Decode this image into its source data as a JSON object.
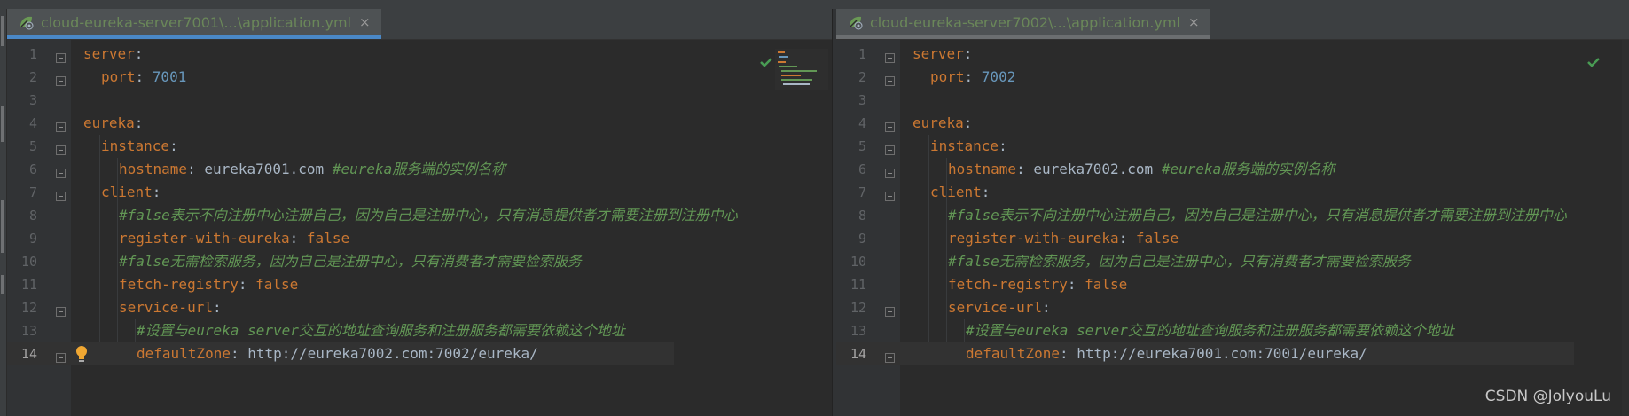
{
  "left_editor": {
    "tab": {
      "title": "cloud-eureka-server7001\\...\\application.yml",
      "close": "×",
      "active": true
    },
    "current_line": 14,
    "lines": [
      {
        "num": "1",
        "indent": 0,
        "key": "server",
        "value": "",
        "vclass": ""
      },
      {
        "num": "2",
        "indent": 1,
        "key": "port",
        "value": "7001",
        "vclass": "n"
      },
      {
        "num": "3",
        "indent": 0,
        "key": "",
        "value": "",
        "vclass": ""
      },
      {
        "num": "4",
        "indent": 0,
        "key": "eureka",
        "value": "",
        "vclass": ""
      },
      {
        "num": "5",
        "indent": 1,
        "key": "instance",
        "value": "",
        "vclass": ""
      },
      {
        "num": "6",
        "indent": 2,
        "key": "hostname",
        "value": "eureka7001.com",
        "vclass": "",
        "comment": "#eureka服务端的实例名称"
      },
      {
        "num": "7",
        "indent": 1,
        "key": "client",
        "value": "",
        "vclass": ""
      },
      {
        "num": "8",
        "indent": 2,
        "comment": "#false表示不向注册中心注册自己，因为自己是注册中心，只有消息提供者才需要注册到注册中心"
      },
      {
        "num": "9",
        "indent": 2,
        "key": "register-with-eureka",
        "value": "false",
        "vclass": "k"
      },
      {
        "num": "10",
        "indent": 2,
        "comment": "#false无需检索服务，因为自己是注册中心，只有消费者才需要检索服务"
      },
      {
        "num": "11",
        "indent": 2,
        "key": "fetch-registry",
        "value": "false",
        "vclass": "k"
      },
      {
        "num": "12",
        "indent": 2,
        "key": "service-url",
        "value": "",
        "vclass": ""
      },
      {
        "num": "13",
        "indent": 3,
        "comment": "#设置与eureka server交互的地址查询服务和注册服务都需要依赖这个地址"
      },
      {
        "num": "14",
        "indent": 3,
        "key": "defaultZone",
        "value": "http://eureka7002.com:7002/eureka/",
        "vclass": ""
      }
    ]
  },
  "right_editor": {
    "tab": {
      "title": "cloud-eureka-server7002\\...\\application.yml",
      "close": "×",
      "active": false
    },
    "current_line": 14,
    "lines": [
      {
        "num": "1",
        "indent": 0,
        "key": "server",
        "value": "",
        "vclass": ""
      },
      {
        "num": "2",
        "indent": 1,
        "key": "port",
        "value": "7002",
        "vclass": "n"
      },
      {
        "num": "3",
        "indent": 0,
        "key": "",
        "value": "",
        "vclass": ""
      },
      {
        "num": "4",
        "indent": 0,
        "key": "eureka",
        "value": "",
        "vclass": ""
      },
      {
        "num": "5",
        "indent": 1,
        "key": "instance",
        "value": "",
        "vclass": ""
      },
      {
        "num": "6",
        "indent": 2,
        "key": "hostname",
        "value": "eureka7002.com",
        "vclass": "",
        "comment": "#eureka服务端的实例名称"
      },
      {
        "num": "7",
        "indent": 1,
        "key": "client",
        "value": "",
        "vclass": ""
      },
      {
        "num": "8",
        "indent": 2,
        "comment": "#false表示不向注册中心注册自己，因为自己是注册中心，只有消息提供者才需要注册到注册中心"
      },
      {
        "num": "9",
        "indent": 2,
        "key": "register-with-eureka",
        "value": "false",
        "vclass": "k"
      },
      {
        "num": "10",
        "indent": 2,
        "comment": "#false无需检索服务，因为自己是注册中心，只有消费者才需要检索服务"
      },
      {
        "num": "11",
        "indent": 2,
        "key": "fetch-registry",
        "value": "false",
        "vclass": "k"
      },
      {
        "num": "12",
        "indent": 2,
        "key": "service-url",
        "value": "",
        "vclass": ""
      },
      {
        "num": "13",
        "indent": 3,
        "comment": "#设置与eureka server交互的地址查询服务和注册服务都需要依赖这个地址"
      },
      {
        "num": "14",
        "indent": 3,
        "key": "defaultZone",
        "value": "http://eureka7001.com:7001/eureka/",
        "vclass": ""
      }
    ]
  },
  "watermark": "CSDN @JolyouLu",
  "colors": {
    "background": "#2b2b2b",
    "gutter": "#313335",
    "key": "#cc7832",
    "number": "#6897bb",
    "comment": "#629755",
    "text": "#a9b7c6",
    "tab_label": "#6a8759",
    "active_tab_underline": "#4a88c7",
    "check": "#499c54"
  },
  "icons": {
    "tab": "spring-yaml-icon",
    "fold": "fold-marker-icon",
    "inspection": "checkmark-icon",
    "intention": "lightbulb-icon"
  }
}
